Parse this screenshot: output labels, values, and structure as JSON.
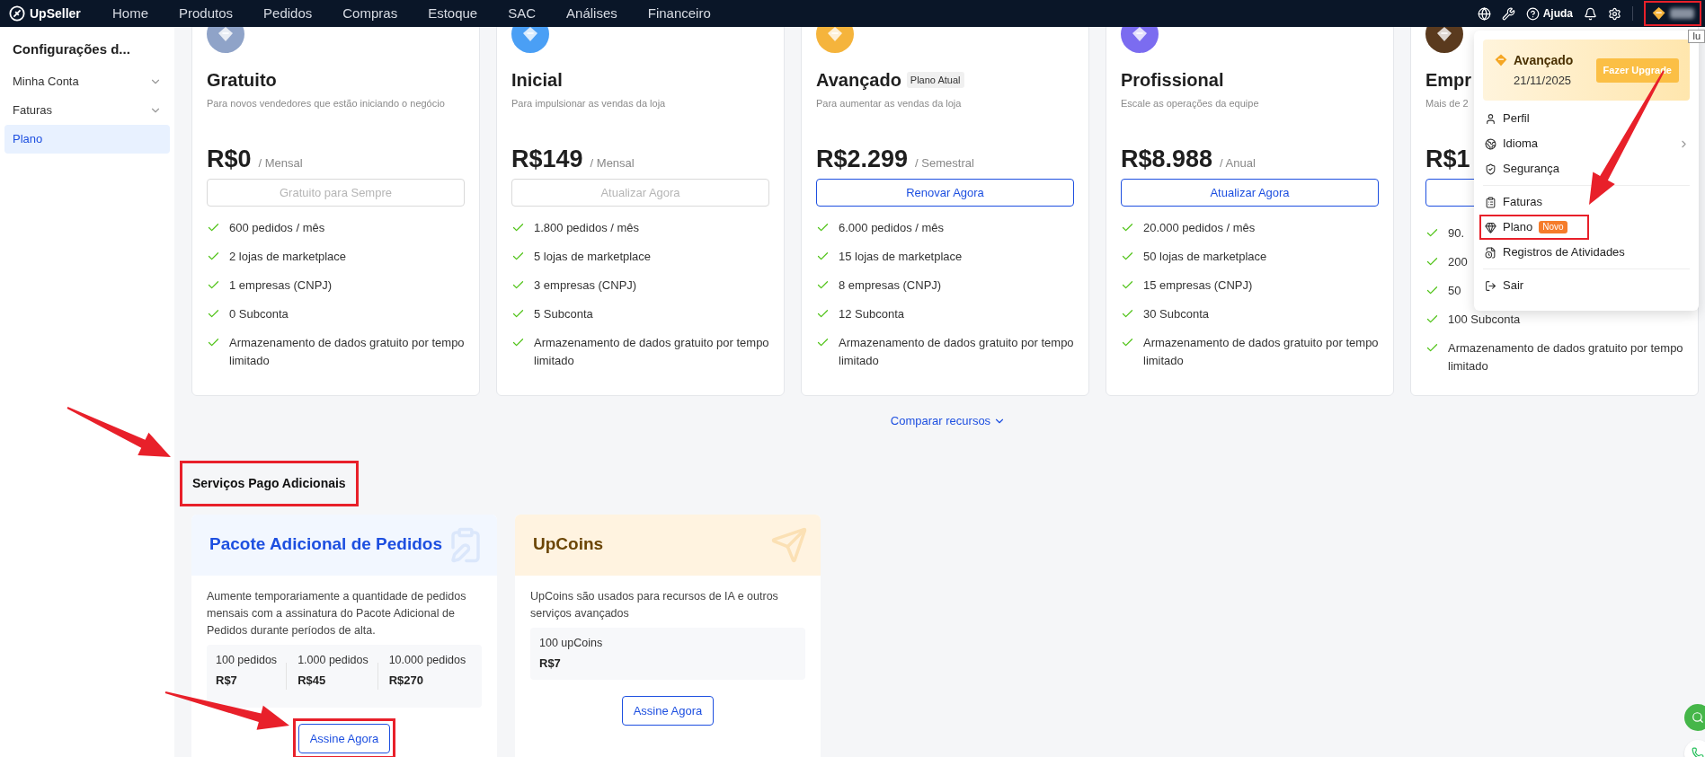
{
  "nav": {
    "logo": "UpSeller",
    "items": [
      "Home",
      "Produtos",
      "Pedidos",
      "Compras",
      "Estoque",
      "SAC",
      "Análises",
      "Financeiro"
    ],
    "help": "Ajuda",
    "avatar_annotated": true,
    "tooltip": "lu"
  },
  "sidebar": {
    "title": "Configurações d...",
    "items": [
      {
        "label": "Minha Conta",
        "expandable": true,
        "selected": false
      },
      {
        "label": "Faturas",
        "expandable": true,
        "selected": false
      },
      {
        "label": "Plano",
        "expandable": false,
        "selected": true
      }
    ]
  },
  "plans": [
    {
      "name": "Gratuito",
      "description": "Para novos vendedores que estão iniciando o negócio",
      "price": "R$0",
      "period": "/ Mensal",
      "button": {
        "label": "Gratuito para Sempre",
        "disabled": true
      },
      "color": "#8fa3c8",
      "features": [
        "600 pedidos / mês",
        "2 lojas de marketplace",
        "1 empresas (CNPJ)",
        "0 Subconta",
        "Armazenamento de dados gratuito por tempo limitado"
      ]
    },
    {
      "name": "Inicial",
      "description": "Para impulsionar as vendas da loja",
      "price": "R$149",
      "period": "/ Mensal",
      "button": {
        "label": "Atualizar Agora",
        "disabled": true
      },
      "color": "#4a9ff5",
      "features": [
        "1.800 pedidos / mês",
        "5 lojas de marketplace",
        "3 empresas (CNPJ)",
        "5 Subconta",
        "Armazenamento de dados gratuito por tempo limitado"
      ]
    },
    {
      "name": "Avançado",
      "badge": "Plano Atual",
      "description": "Para aumentar as vendas da loja",
      "price": "R$2.299",
      "period": "/ Semestral",
      "button": {
        "label": "Renovar Agora",
        "disabled": false
      },
      "color": "#f5b43c",
      "features": [
        "6.000 pedidos / mês",
        "15 lojas de marketplace",
        "8 empresas (CNPJ)",
        "12 Subconta",
        "Armazenamento de dados gratuito por tempo limitado"
      ]
    },
    {
      "name": "Profissional",
      "description": "Escale as operações da equipe",
      "price": "R$8.988",
      "period": "/ Anual",
      "button": {
        "label": "Atualizar Agora",
        "disabled": false
      },
      "color": "#7b6cf0",
      "features": [
        "20.000 pedidos / mês",
        "50 lojas de marketplace",
        "15 empresas (CNPJ)",
        "30 Subconta",
        "Armazenamento de dados gratuito por tempo limitado"
      ]
    },
    {
      "name": "Empr",
      "description": "Mais de 2",
      "price": "R$1",
      "button": {
        "disabled": false
      },
      "color": "#5a3a1e",
      "features": [
        "90.",
        "200",
        "50",
        "100 Subconta",
        "Armazenamento de dados gratuito por tempo limitado"
      ]
    }
  ],
  "compare_link": "Comparar recursos",
  "services": {
    "title": "Serviços Pago Adicionais",
    "annotated": true,
    "cards": [
      {
        "kind": "orders",
        "title": "Pacote Adicional de Pedidos",
        "description": "Aumente temporariamente a quantidade de pedidos mensais com a assinatura do Pacote Adicional de Pedidos durante períodos de alta.",
        "options": [
          {
            "label": "100 pedidos",
            "price": "R$7"
          },
          {
            "label": "1.000 pedidos",
            "price": "R$45"
          },
          {
            "label": "10.000 pedidos",
            "price": "R$270"
          }
        ],
        "button": "Assine Agora",
        "annotated": true
      },
      {
        "kind": "coins",
        "title": "UpCoins",
        "description": "UpCoins são usados para recursos de IA e outros serviços avançados",
        "options": [
          {
            "label": "100 upCoins",
            "price": "R$7"
          }
        ],
        "button": "Assine Agora",
        "annotated": false
      }
    ]
  },
  "account_menu": {
    "plan": "Avançado",
    "expiry": "21/11/2025",
    "upgrade": "Fazer Upgrade",
    "groups": [
      [
        {
          "label": "Perfil",
          "submenu": false,
          "annotated": false
        },
        {
          "label": "Idioma",
          "submenu": true,
          "annotated": false
        },
        {
          "label": "Segurança",
          "submenu": false,
          "annotated": false
        }
      ],
      [
        {
          "label": "Faturas",
          "submenu": false,
          "annotated": false
        },
        {
          "label": "Plano",
          "badge": "Novo",
          "submenu": false,
          "annotated": true
        },
        {
          "label": "Registros de Atividades",
          "submenu": false,
          "annotated": false
        }
      ],
      [
        {
          "label": "Sair",
          "submenu": false,
          "annotated": false
        }
      ]
    ]
  }
}
